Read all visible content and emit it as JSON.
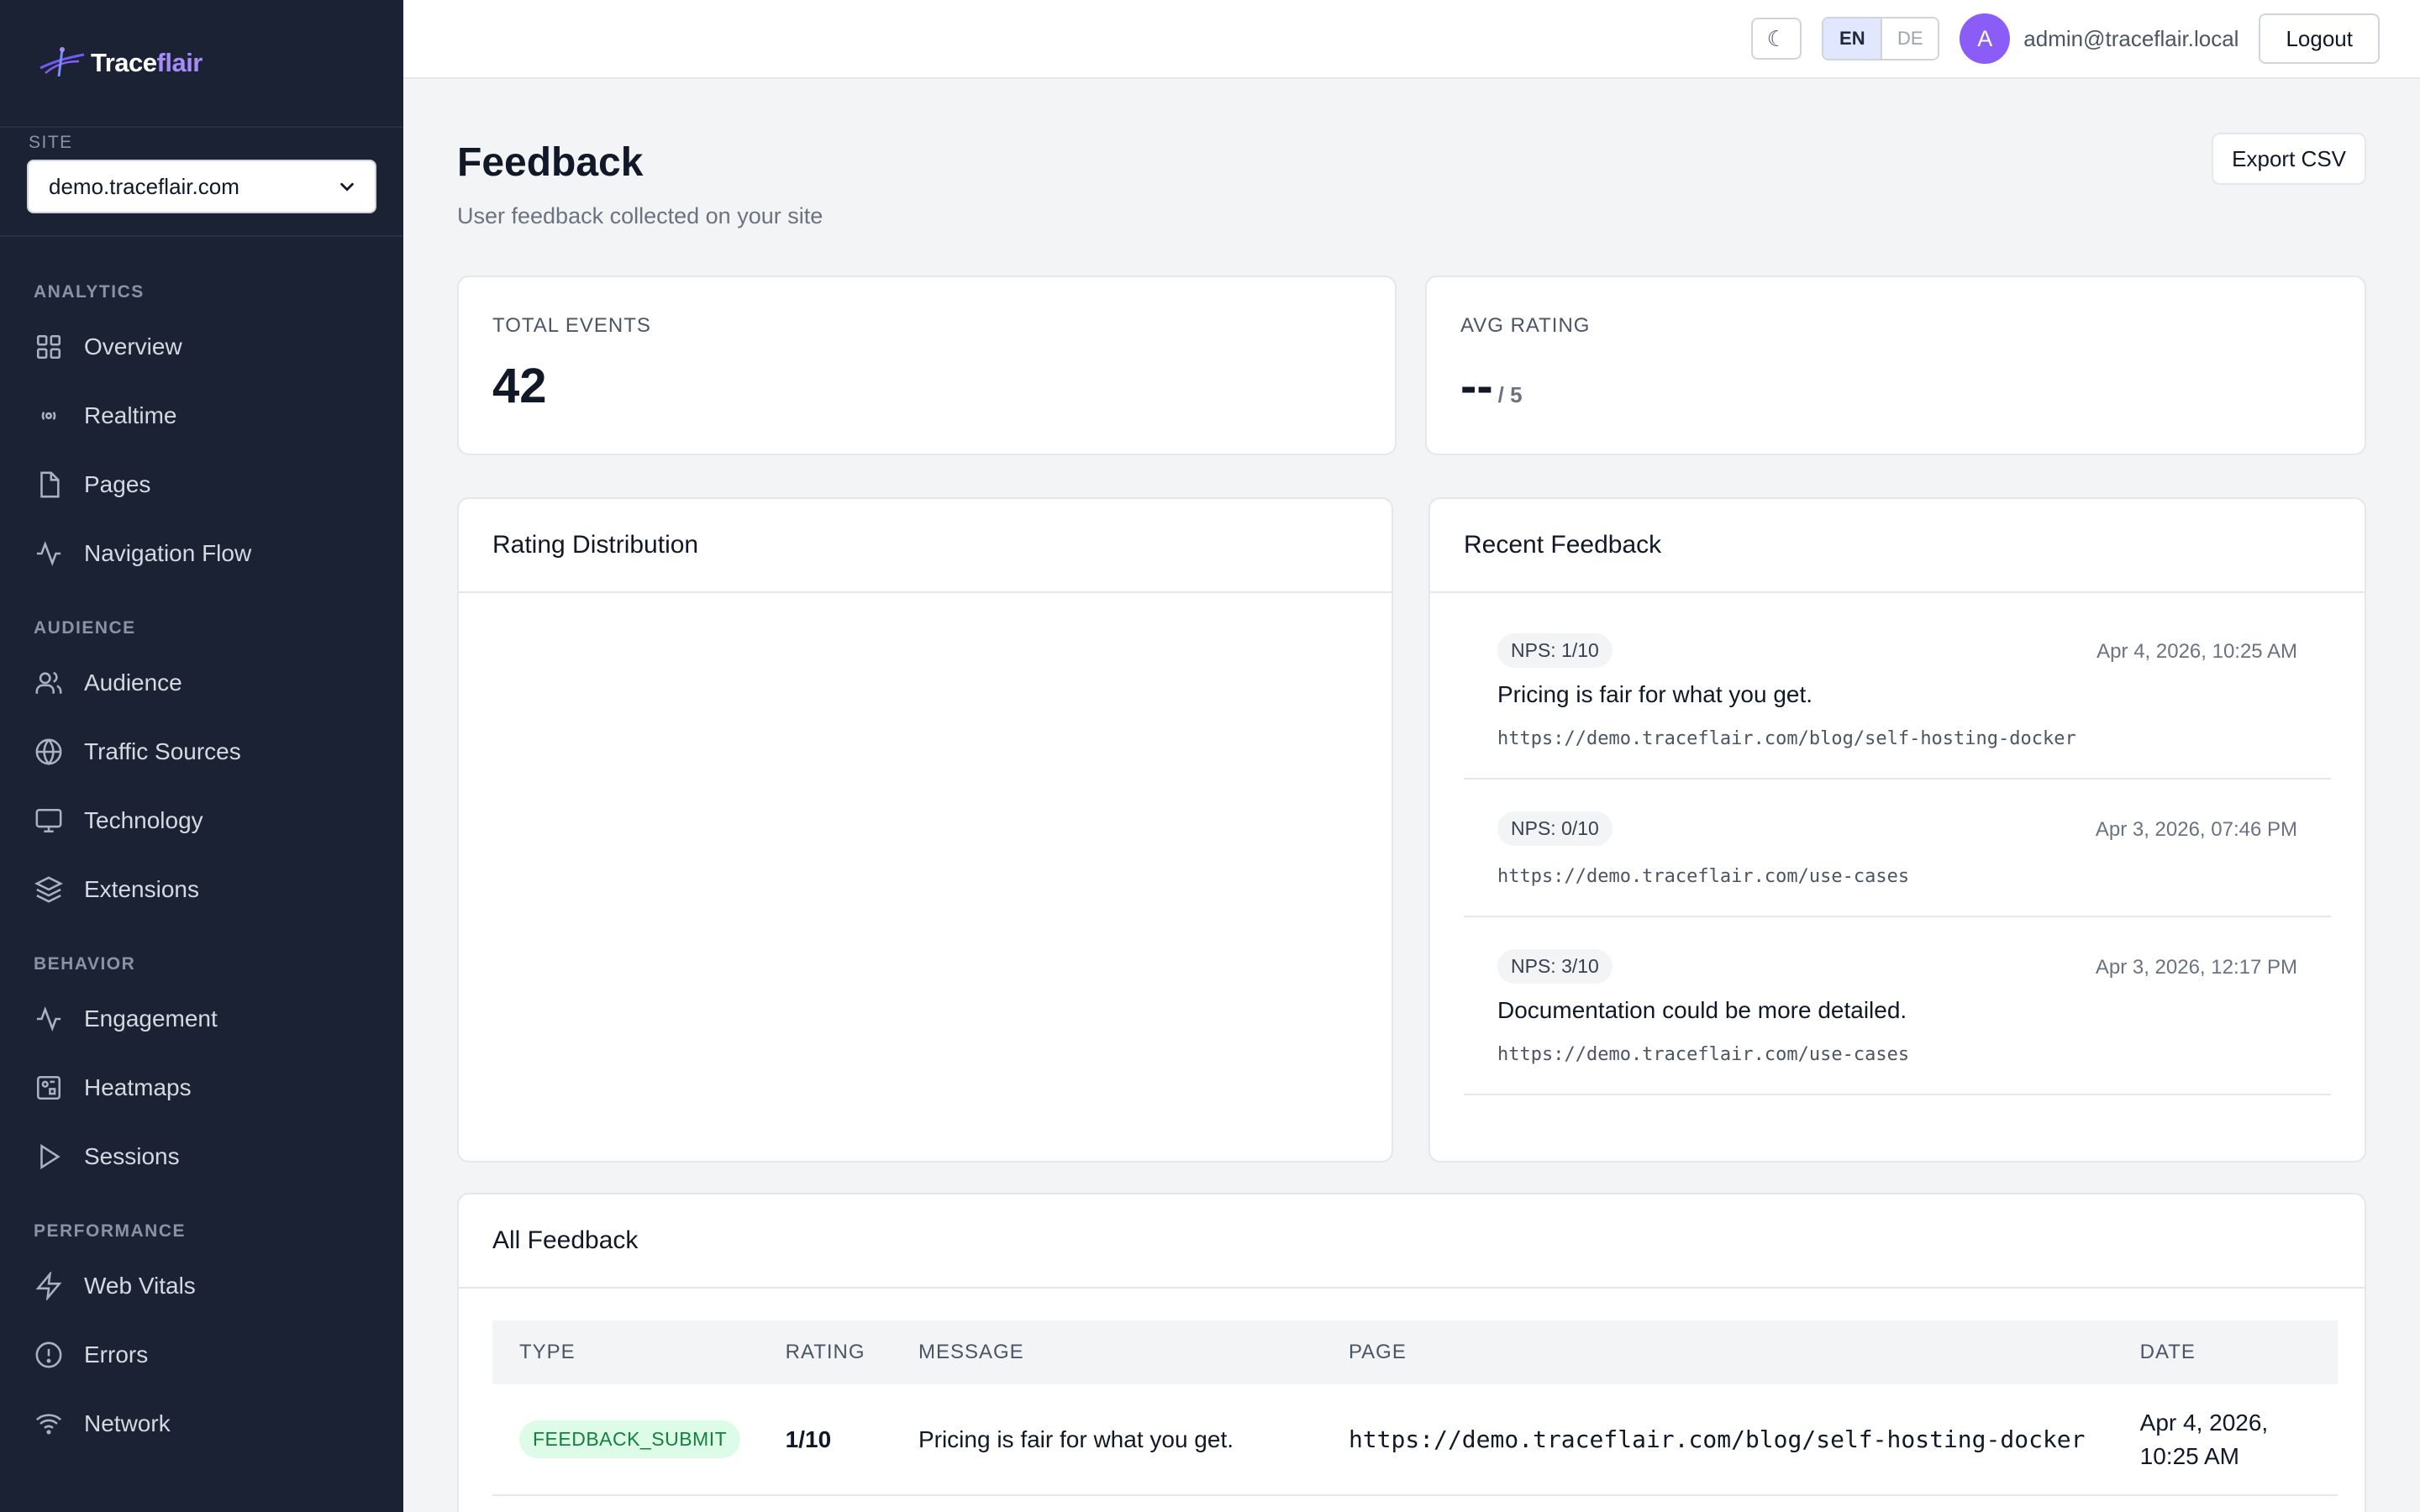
{
  "brand": {
    "name_prefix": "Trace",
    "name_accent": "flair"
  },
  "site": {
    "label": "SITE",
    "selected": "demo.traceflair.com"
  },
  "nav": {
    "analytics": {
      "title": "ANALYTICS",
      "items": [
        "Overview",
        "Realtime",
        "Pages",
        "Navigation Flow"
      ]
    },
    "audience": {
      "title": "AUDIENCE",
      "items": [
        "Audience",
        "Traffic Sources",
        "Technology",
        "Extensions"
      ]
    },
    "behavior": {
      "title": "BEHAVIOR",
      "items": [
        "Engagement",
        "Heatmaps",
        "Sessions"
      ]
    },
    "performance": {
      "title": "PERFORMANCE",
      "items": [
        "Web Vitals",
        "Errors",
        "Network"
      ]
    }
  },
  "topbar": {
    "theme_icon": "☾",
    "lang_active": "EN",
    "lang_inactive": "DE",
    "avatar_initial": "A",
    "user_email": "admin@traceflair.local",
    "logout_label": "Logout"
  },
  "page": {
    "title": "Feedback",
    "subtitle": "User feedback collected on your site",
    "export_label": "Export CSV"
  },
  "stats": {
    "total_events_label": "TOTAL EVENTS",
    "total_events_value": "42",
    "avg_rating_label": "AVG RATING",
    "avg_rating_value": "--",
    "avg_rating_suffix": "/ 5"
  },
  "rating_distribution": {
    "title": "Rating Distribution"
  },
  "recent_feedback": {
    "title": "Recent Feedback",
    "items": [
      {
        "badge": "NPS: 1/10",
        "date": "Apr 4, 2026, 10:25 AM",
        "message": "Pricing is fair for what you get.",
        "url": "https://demo.traceflair.com/blog/self-hosting-docker"
      },
      {
        "badge": "NPS: 0/10",
        "date": "Apr 3, 2026, 07:46 PM",
        "message": "",
        "url": "https://demo.traceflair.com/use-cases"
      },
      {
        "badge": "NPS: 3/10",
        "date": "Apr 3, 2026, 12:17 PM",
        "message": "Documentation could be more detailed.",
        "url": "https://demo.traceflair.com/use-cases"
      }
    ]
  },
  "all_feedback": {
    "title": "All Feedback",
    "columns": [
      "TYPE",
      "RATING",
      "MESSAGE",
      "PAGE",
      "DATE"
    ],
    "rows": [
      {
        "type": "FEEDBACK_SUBMIT",
        "rating": "1/10",
        "message": "Pricing is fair for what you get.",
        "page": "https://demo.traceflair.com/blog/self-hosting-docker",
        "date": "Apr 4, 2026, 10:25 AM"
      }
    ]
  },
  "colors": {
    "sidebar_bg": "#1b2233",
    "accent": "#8b5cf6",
    "badge_green": "#dcfce7"
  }
}
